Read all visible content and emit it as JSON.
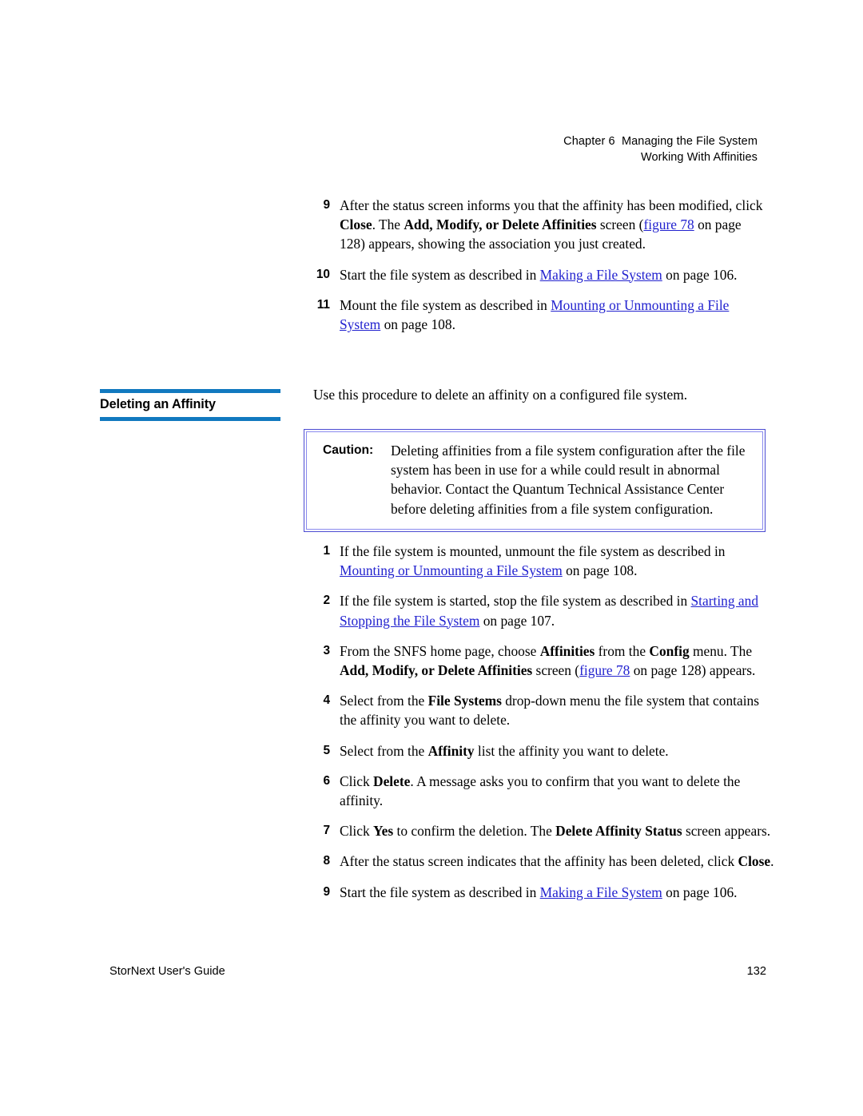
{
  "header": {
    "line1": "Chapter 6  Managing the File System",
    "line2": "Working With Affinities"
  },
  "steps_top": [
    {
      "number": "9",
      "parts": [
        {
          "t": "After the status screen informs you that the affinity has been modified, click ",
          "s": "normal"
        },
        {
          "t": "Close",
          "s": "bold"
        },
        {
          "t": ". The ",
          "s": "normal"
        },
        {
          "t": "Add, Modify, or Delete Affinities",
          "s": "bold"
        },
        {
          "t": " screen (",
          "s": "normal"
        },
        {
          "t": "figure 78",
          "s": "link"
        },
        {
          "t": " on page 128) appears, showing the association you just created.",
          "s": "normal"
        }
      ]
    },
    {
      "number": "10",
      "parts": [
        {
          "t": "Start the file system as described in ",
          "s": "normal"
        },
        {
          "t": "Making a File System",
          "s": "link"
        },
        {
          "t": " on page  106.",
          "s": "normal"
        }
      ]
    },
    {
      "number": "11",
      "parts": [
        {
          "t": "Mount the file system as described in ",
          "s": "normal"
        },
        {
          "t": "Mounting or Unmounting a File System",
          "s": "link"
        },
        {
          "t": " on page  108.",
          "s": "normal"
        }
      ]
    }
  ],
  "section": {
    "heading": "Deleting an Affinity",
    "intro": "Use this procedure to delete an affinity on a configured file system."
  },
  "caution": {
    "label": "Caution:",
    "text": "Deleting affinities from a file system configuration after the file system has been in use for a while could result in abnormal behavior. Contact the Quantum Technical Assistance Center before deleting affinities from a file system configuration."
  },
  "steps_bottom": [
    {
      "number": "1",
      "parts": [
        {
          "t": "If the file system is mounted, unmount the file system as described in ",
          "s": "normal"
        },
        {
          "t": "Mounting or Unmounting a File System",
          "s": "link"
        },
        {
          "t": " on page  108.",
          "s": "normal"
        }
      ]
    },
    {
      "number": "2",
      "parts": [
        {
          "t": "If the file system is started, stop the file system as described in ",
          "s": "normal"
        },
        {
          "t": "Starting and Stopping the File System",
          "s": "link"
        },
        {
          "t": " on page  107.",
          "s": "normal"
        }
      ]
    },
    {
      "number": "3",
      "parts": [
        {
          "t": "From the SNFS home page, choose ",
          "s": "normal"
        },
        {
          "t": "Affinities",
          "s": "bold"
        },
        {
          "t": " from the ",
          "s": "normal"
        },
        {
          "t": "Config",
          "s": "bold"
        },
        {
          "t": " menu. The ",
          "s": "normal"
        },
        {
          "t": "Add, Modify, or Delete Affinities",
          "s": "bold"
        },
        {
          "t": " screen (",
          "s": "normal"
        },
        {
          "t": "figure 78",
          "s": "link"
        },
        {
          "t": " on page 128) appears.",
          "s": "normal"
        }
      ]
    },
    {
      "number": "4",
      "parts": [
        {
          "t": "Select from the ",
          "s": "normal"
        },
        {
          "t": "File Systems",
          "s": "bold"
        },
        {
          "t": " drop-down menu the file system that contains the affinity you want to delete.",
          "s": "normal"
        }
      ]
    },
    {
      "number": "5",
      "parts": [
        {
          "t": "Select from the ",
          "s": "normal"
        },
        {
          "t": "Affinity",
          "s": "bold"
        },
        {
          "t": " list the affinity you want to delete.",
          "s": "normal"
        }
      ]
    },
    {
      "number": "6",
      "parts": [
        {
          "t": "Click ",
          "s": "normal"
        },
        {
          "t": "Delete",
          "s": "bold"
        },
        {
          "t": ". A message asks you to confirm that you want to delete the affinity.",
          "s": "normal"
        }
      ]
    },
    {
      "number": "7",
      "parts": [
        {
          "t": "Click ",
          "s": "normal"
        },
        {
          "t": "Yes",
          "s": "bold"
        },
        {
          "t": " to confirm the deletion. The ",
          "s": "normal"
        },
        {
          "t": "Delete Affinity Status",
          "s": "bold"
        },
        {
          "t": " screen appears.",
          "s": "normal"
        }
      ]
    },
    {
      "number": "8",
      "parts": [
        {
          "t": "After the status screen indicates that the affinity has been deleted, click ",
          "s": "normal"
        },
        {
          "t": "Close",
          "s": "bold"
        },
        {
          "t": ".",
          "s": "normal"
        }
      ]
    },
    {
      "number": "9",
      "parts": [
        {
          "t": "Start the file system as described in ",
          "s": "normal"
        },
        {
          "t": "Making a File System",
          "s": "link"
        },
        {
          "t": " on page  106.",
          "s": "normal"
        }
      ]
    }
  ],
  "footer": {
    "guide_title": "StorNext User's Guide",
    "page_number": "132"
  },
  "colors": {
    "link": "#2222cf",
    "heading_rule": "#1179bf",
    "caution_border_outer": "#4b4bd2",
    "caution_border_inner": "#8a8aee"
  }
}
